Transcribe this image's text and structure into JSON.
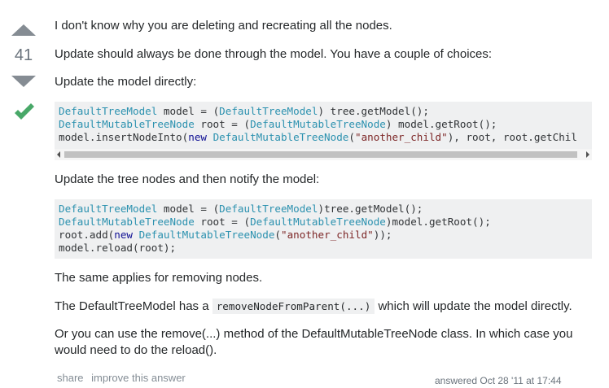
{
  "vote": {
    "count": "41"
  },
  "answer": {
    "p1": "I don't know why you are deleting and recreating all the nodes.",
    "p2": "Update should always be done through the model. You have a couple of choices:",
    "p3": "Update the model directly:",
    "code1": {
      "l1": {
        "a": "DefaultTreeModel",
        "b": " model = (",
        "c": "DefaultTreeModel",
        "d": ") tree.getModel();"
      },
      "l2": {
        "a": "DefaultMutableTreeNode",
        "b": " root = (",
        "c": "DefaultMutableTreeNode",
        "d": ") model.getRoot();"
      },
      "l3": {
        "a": "model.insertNodeInto(",
        "b": "new",
        "c": " ",
        "d": "DefaultMutableTreeNode",
        "e": "(",
        "f": "\"another_child\"",
        "g": "), root, root.getChil"
      }
    },
    "p4": "Update the tree nodes and then notify the model:",
    "code2": {
      "l1": {
        "a": "DefaultTreeModel",
        "b": " model = (",
        "c": "DefaultTreeModel",
        "d": ")tree.getModel();"
      },
      "l2": {
        "a": "DefaultMutableTreeNode",
        "b": " root = (",
        "c": "DefaultMutableTreeNode",
        "d": ")model.getRoot();"
      },
      "l3": {
        "a": "root.add(",
        "b": "new",
        "c": " ",
        "d": "DefaultMutableTreeNode",
        "e": "(",
        "f": "\"another_child\"",
        "g": "));"
      },
      "l4": "model.reload(root);"
    },
    "p5": "The same applies for removing nodes.",
    "p6": {
      "before": "The DefaultTreeModel has a ",
      "code": "removeNodeFromParent(...)",
      "after": " which will update the model directly."
    },
    "p7": "Or you can use the remove(...) method of the DefaultMutableTreeNode class. In which case you would need to do the reload()."
  },
  "menu": {
    "share": "share",
    "improve": "improve this answer"
  },
  "signature": {
    "text": "answered Oct 28 '11 at 17:44"
  },
  "colors": {
    "vote_arrow": "#858c93",
    "accepted": "#48a868",
    "code_bg": "#eff0f1",
    "type": "#2b91af",
    "keyword": "#101094",
    "string": "#7d2727"
  }
}
